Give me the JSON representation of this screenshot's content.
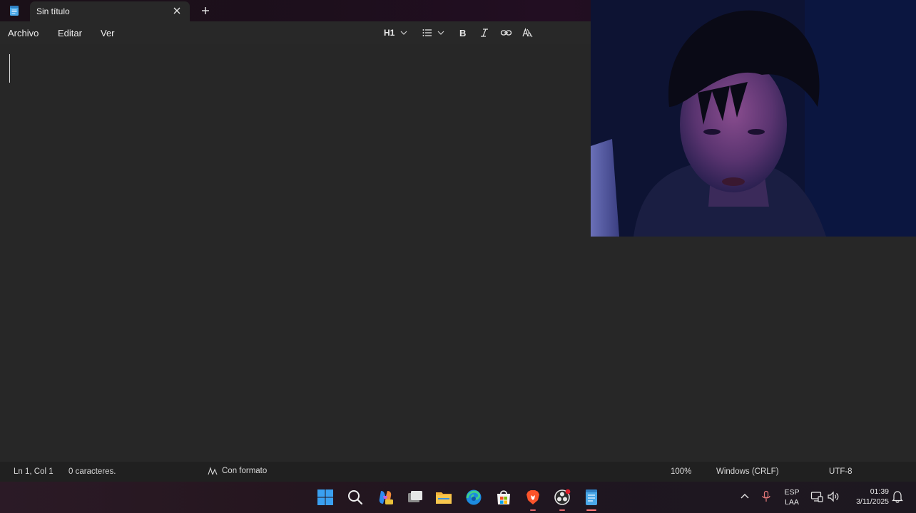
{
  "tab": {
    "title": "Sin título"
  },
  "menu": {
    "file": "Archivo",
    "edit": "Editar",
    "view": "Ver"
  },
  "toolbar": {
    "heading": "H1"
  },
  "status": {
    "position": "Ln 1, Col 1",
    "characters": "0 caracteres.",
    "format": "Con formato",
    "zoom": "100%",
    "line_endings": "Windows (CRLF)",
    "encoding": "UTF-8"
  },
  "tray": {
    "lang_1": "ESP",
    "lang_2": "LAA",
    "time": "01:39",
    "date": "3/11/2025"
  },
  "icons": {
    "app": "notepad-icon",
    "close": "close-icon",
    "new_tab": "plus-icon",
    "list": "list-icon",
    "bold": "bold-icon",
    "italic": "italic-icon",
    "link": "link-icon",
    "clear_format": "clear-format-icon",
    "taskbar": [
      "windows-start-icon",
      "search-icon",
      "copilot-icon",
      "task-view-icon",
      "file-explorer-icon",
      "edge-icon",
      "store-icon",
      "brave-icon",
      "obs-icon",
      "notepad-icon"
    ]
  },
  "colors": {
    "accent": "#e0666a",
    "editor_bg": "#272727",
    "status_bg": "#202020"
  }
}
